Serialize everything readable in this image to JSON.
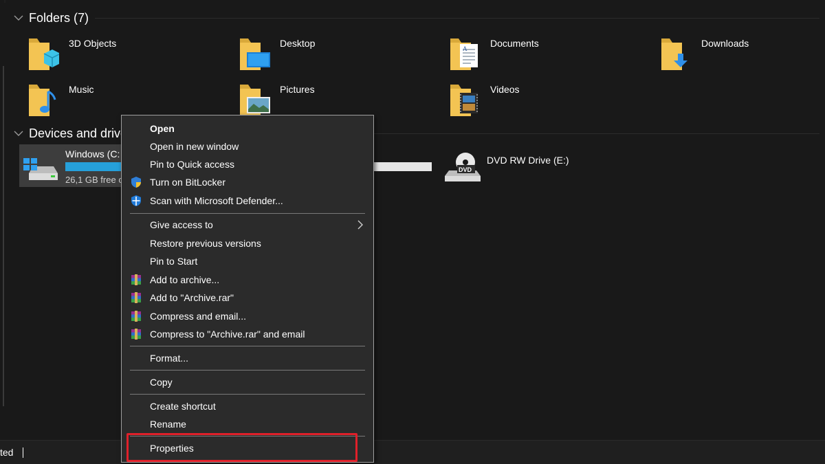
{
  "colors": {
    "background": "#191919",
    "menu_background": "#2b2b2b",
    "drive_bar": "#26a0da",
    "highlight": "#e0202a",
    "folder": "#f3c453"
  },
  "groups": {
    "folders": {
      "label": "Folders (7)"
    },
    "devices": {
      "label": "Devices and drive"
    }
  },
  "folders": [
    {
      "label": "3D Objects",
      "icon": "3d-objects-folder-icon"
    },
    {
      "label": "Desktop",
      "icon": "desktop-folder-icon"
    },
    {
      "label": "Documents",
      "icon": "documents-folder-icon"
    },
    {
      "label": "Downloads",
      "icon": "downloads-folder-icon"
    },
    {
      "label": "Music",
      "icon": "music-folder-icon"
    },
    {
      "label": "Pictures",
      "icon": "pictures-folder-icon"
    },
    {
      "label": "Videos",
      "icon": "videos-folder-icon"
    }
  ],
  "drives": {
    "c": {
      "label": "Windows (C:",
      "free": "26,1 GB free c",
      "icon": "windows-drive-icon",
      "used_fraction": 0.85
    },
    "e": {
      "label": "DVD RW Drive (E:)",
      "icon": "dvd-drive-icon"
    }
  },
  "status_bar": {
    "text": "ted"
  },
  "context_menu": {
    "items": [
      {
        "label": "Open",
        "icon": ""
      },
      {
        "label": "Open in new window",
        "icon": ""
      },
      {
        "label": "Pin to Quick access",
        "icon": ""
      },
      {
        "label": "Turn on BitLocker",
        "icon": "uac-shield-icon"
      },
      {
        "label": "Scan with Microsoft Defender...",
        "icon": "defender-shield-icon"
      },
      {
        "label": "Give access to",
        "icon": "",
        "submenu": true
      },
      {
        "label": "Restore previous versions",
        "icon": ""
      },
      {
        "label": "Pin to Start",
        "icon": ""
      },
      {
        "label": "Add to archive...",
        "icon": "winrar-icon"
      },
      {
        "label": "Add to \"Archive.rar\"",
        "icon": "winrar-icon"
      },
      {
        "label": "Compress and email...",
        "icon": "winrar-icon"
      },
      {
        "label": "Compress to \"Archive.rar\" and email",
        "icon": "winrar-icon"
      },
      {
        "label": "Format...",
        "icon": ""
      },
      {
        "label": "Copy",
        "icon": ""
      },
      {
        "label": "Create shortcut",
        "icon": ""
      },
      {
        "label": "Rename",
        "icon": ""
      },
      {
        "label": "Properties",
        "icon": "",
        "highlighted": true
      }
    ]
  }
}
